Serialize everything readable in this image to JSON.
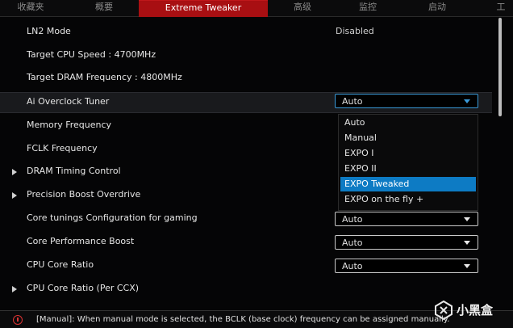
{
  "tabs": [
    {
      "label": "收藏夹",
      "active": false
    },
    {
      "label": "概要",
      "active": false
    },
    {
      "label": "Extreme Tweaker",
      "active": true
    },
    {
      "label": "高级",
      "active": false
    },
    {
      "label": "监控",
      "active": false
    },
    {
      "label": "启动",
      "active": false
    },
    {
      "label": "工",
      "active": false
    }
  ],
  "settings": {
    "ln2_mode": {
      "label": "LN2 Mode",
      "value": "Disabled"
    },
    "target_cpu": {
      "label": "Target CPU Speed : 4700MHz"
    },
    "target_dram": {
      "label": "Target DRAM Frequency : 4800MHz"
    },
    "ai_tuner": {
      "label": "Ai Overclock Tuner",
      "value": "Auto"
    },
    "memory_freq": {
      "label": "Memory Frequency"
    },
    "fclk_freq": {
      "label": "FCLK Frequency"
    },
    "dram_timing": {
      "label": "DRAM Timing Control"
    },
    "pbo": {
      "label": "Precision Boost Overdrive"
    },
    "core_tunings": {
      "label": "Core tunings Configuration for gaming",
      "value": "Auto"
    },
    "core_perf_boost": {
      "label": "Core Performance Boost",
      "value": "Auto"
    },
    "cpu_core_ratio": {
      "label": "CPU Core Ratio",
      "value": "Auto"
    },
    "cpu_core_ratio_ccx": {
      "label": "CPU Core Ratio (Per CCX)"
    }
  },
  "dropdown": {
    "options": [
      "Auto",
      "Manual",
      "EXPO I",
      "EXPO II",
      "EXPO Tweaked",
      "EXPO on the fly +"
    ],
    "selected_index": 4
  },
  "help": {
    "text": "[Manual]: When manual mode is selected, the BCLK (base clock) frequency can be assigned manually."
  },
  "watermark": {
    "name": "小黑盒"
  },
  "colors": {
    "accent_tab": "#a80f12",
    "selected_option": "#0d7bc4",
    "open_select_border": "#3a9ad8",
    "info_icon": "#dd3333"
  }
}
